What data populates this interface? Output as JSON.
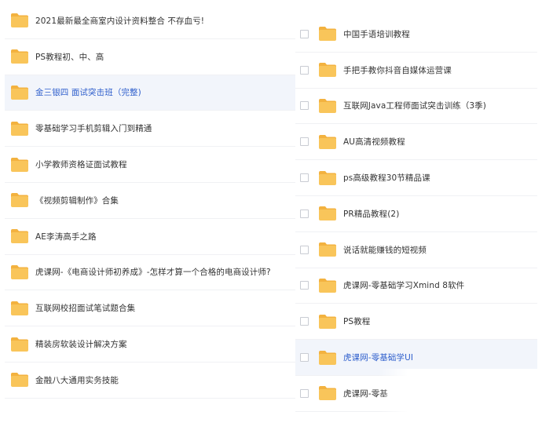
{
  "left_panel": {
    "items": [
      {
        "label": "2021最新最全商室内设计资料整合 不存血亏!",
        "highlighted": false
      },
      {
        "label": "PS教程初、中、高",
        "highlighted": false
      },
      {
        "label": "金三银四 面试突击班（完整)",
        "highlighted": true
      },
      {
        "label": "零基础学习手机剪辑入门到精通",
        "highlighted": false
      },
      {
        "label": "小学教师资格证面试教程",
        "highlighted": false
      },
      {
        "label": "《视频剪辑制作》合集",
        "highlighted": false
      },
      {
        "label": "AE李涛高手之路",
        "highlighted": false
      },
      {
        "label": "虎课网-《电商设计师初养成》-怎样才算一个合格的电商设计师?",
        "highlighted": false
      },
      {
        "label": "互联网校招面试笔试题合集",
        "highlighted": false
      },
      {
        "label": "精装房软装设计解决方案",
        "highlighted": false
      },
      {
        "label": "金融八大通用实务技能",
        "highlighted": false
      }
    ]
  },
  "right_panel": {
    "items": [
      {
        "label": "中国手语培训教程",
        "highlighted": false
      },
      {
        "label": "手把手教你抖音自媒体运营课",
        "highlighted": false
      },
      {
        "label": "互联网Java工程师面试突击训练（3季)",
        "highlighted": false
      },
      {
        "label": "AU高清视频教程",
        "highlighted": false
      },
      {
        "label": "ps高级教程30节精品课",
        "highlighted": false
      },
      {
        "label": "PR精品教程(2)",
        "highlighted": false
      },
      {
        "label": "说话就能赚钱的短视频",
        "highlighted": false
      },
      {
        "label": "虎课网-零基础学习Xmind 8软件",
        "highlighted": false
      },
      {
        "label": "PS教程",
        "highlighted": false
      },
      {
        "label": "虎课网-零基础学UI",
        "highlighted": true
      },
      {
        "label": "虎课网-零基",
        "highlighted": false
      }
    ]
  },
  "colors": {
    "folder_body": "#f9c55a",
    "folder_tab": "#f3b23f",
    "highlight_bg": "#f2f5fb",
    "highlight_text": "#2f5fcc",
    "text": "#333333"
  },
  "icons": {
    "folder": "folder-icon",
    "checkbox": "checkbox-icon"
  }
}
